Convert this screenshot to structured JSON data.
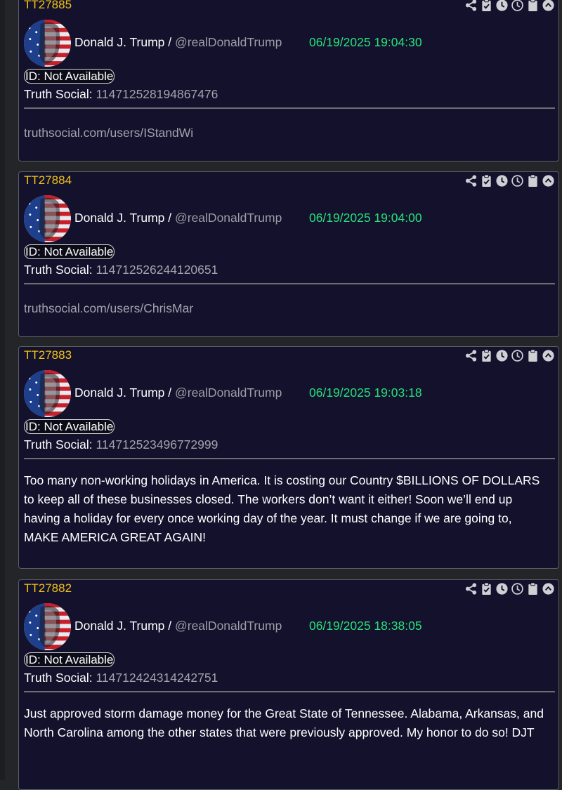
{
  "posts": [
    {
      "tt_id": "TT27885",
      "author_name": "Donald J. Trump",
      "separator": " / ",
      "handle": "@realDonaldTrump",
      "timestamp": "06/19/2025 19:04:30",
      "id_badge": "ID: Not Available",
      "truth_social_label": "Truth Social:",
      "truth_social_id": "114712528194867476",
      "content": "truthsocial.com/users/IStandWi",
      "content_is_link": true
    },
    {
      "tt_id": "TT27884",
      "author_name": "Donald J. Trump",
      "separator": " / ",
      "handle": "@realDonaldTrump",
      "timestamp": "06/19/2025 19:04:00",
      "id_badge": "ID: Not Available",
      "truth_social_label": "Truth Social:",
      "truth_social_id": "114712526244120651",
      "content": "truthsocial.com/users/ChrisMar",
      "content_is_link": true
    },
    {
      "tt_id": "TT27883",
      "author_name": "Donald J. Trump",
      "separator": " / ",
      "handle": "@realDonaldTrump",
      "timestamp": "06/19/2025 19:03:18",
      "id_badge": "ID: Not Available",
      "truth_social_label": "Truth Social:",
      "truth_social_id": "114712523496772999",
      "content": "Too many non-working holidays in America. It is costing our Country $BILLIONS OF DOLLARS to keep all of these businesses closed. The workers don’t want it either! Soon we’ll end up having a holiday for every once working day of the year. It must change if we are going to, MAKE AMERICA GREAT AGAIN!",
      "content_is_link": false
    },
    {
      "tt_id": "TT27882",
      "author_name": "Donald J. Trump",
      "separator": " / ",
      "handle": "@realDonaldTrump",
      "timestamp": "06/19/2025 18:38:05",
      "id_badge": "ID: Not Available",
      "truth_social_label": "Truth Social:",
      "truth_social_id": "114712424314242751",
      "content": "Just approved storm damage money for the Great State of Tennessee. Alabama, Arkansas, and North Carolina among the other states that were previously approved. My honor to do so! DJT",
      "content_is_link": false
    }
  ],
  "action_icons": [
    "share-icon",
    "clipboard-check-icon",
    "clock-solid-icon",
    "clock-outline-icon",
    "clipboard-icon",
    "collapse-up-icon"
  ],
  "colors": {
    "background": "#232528",
    "card": "#13112c",
    "tt_id": "#f2c414",
    "timestamp": "#27e27b",
    "muted": "#a3a3ad"
  }
}
